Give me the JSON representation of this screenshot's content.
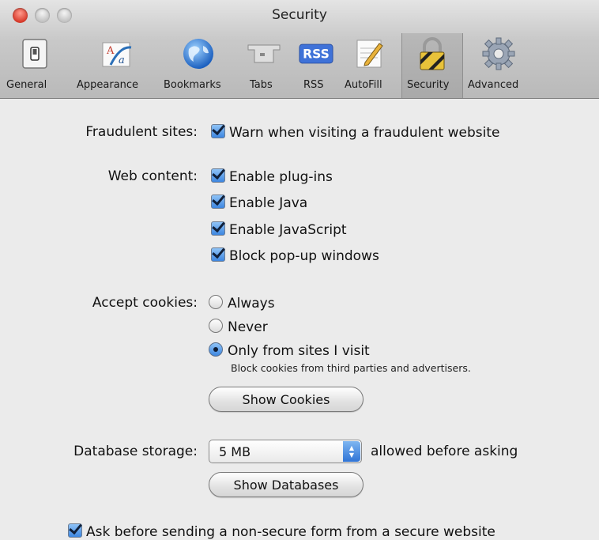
{
  "window": {
    "title": "Security"
  },
  "toolbar": {
    "items": [
      {
        "label": "General",
        "icon": "general-switch-icon"
      },
      {
        "label": "Appearance",
        "icon": "appearance-font-icon"
      },
      {
        "label": "Bookmarks",
        "icon": "globe-icon"
      },
      {
        "label": "Tabs",
        "icon": "tabs-icon"
      },
      {
        "label": "RSS",
        "icon": "rss-icon"
      },
      {
        "label": "AutoFill",
        "icon": "autofill-pencil-icon"
      },
      {
        "label": "Security",
        "icon": "padlock-icon",
        "selected": true
      },
      {
        "label": "Advanced",
        "icon": "gear-icon"
      }
    ]
  },
  "fraud": {
    "label": "Fraudulent sites:",
    "warn": {
      "label": "Warn when visiting a fraudulent website",
      "checked": true
    }
  },
  "web_content": {
    "label": "Web content:",
    "options": [
      {
        "label": "Enable plug-ins",
        "checked": true
      },
      {
        "label": "Enable Java",
        "checked": true
      },
      {
        "label": "Enable JavaScript",
        "checked": true
      },
      {
        "label": "Block pop-up windows",
        "checked": true
      }
    ]
  },
  "cookies": {
    "label": "Accept cookies:",
    "options": [
      {
        "label": "Always",
        "selected": false
      },
      {
        "label": "Never",
        "selected": false
      },
      {
        "label": "Only from sites I visit",
        "selected": true
      }
    ],
    "note": "Block cookies from third parties and advertisers.",
    "show_button": "Show Cookies"
  },
  "database": {
    "label": "Database storage:",
    "value": "5 MB",
    "suffix": "allowed before asking",
    "show_button": "Show Databases"
  },
  "nonsecure": {
    "label": "Ask before sending a non-secure form from a secure website",
    "checked": true
  },
  "colors": {
    "accent": "#3d86e0",
    "toolbar_bg": "#c4c4c4",
    "content_bg": "#ebebeb"
  }
}
